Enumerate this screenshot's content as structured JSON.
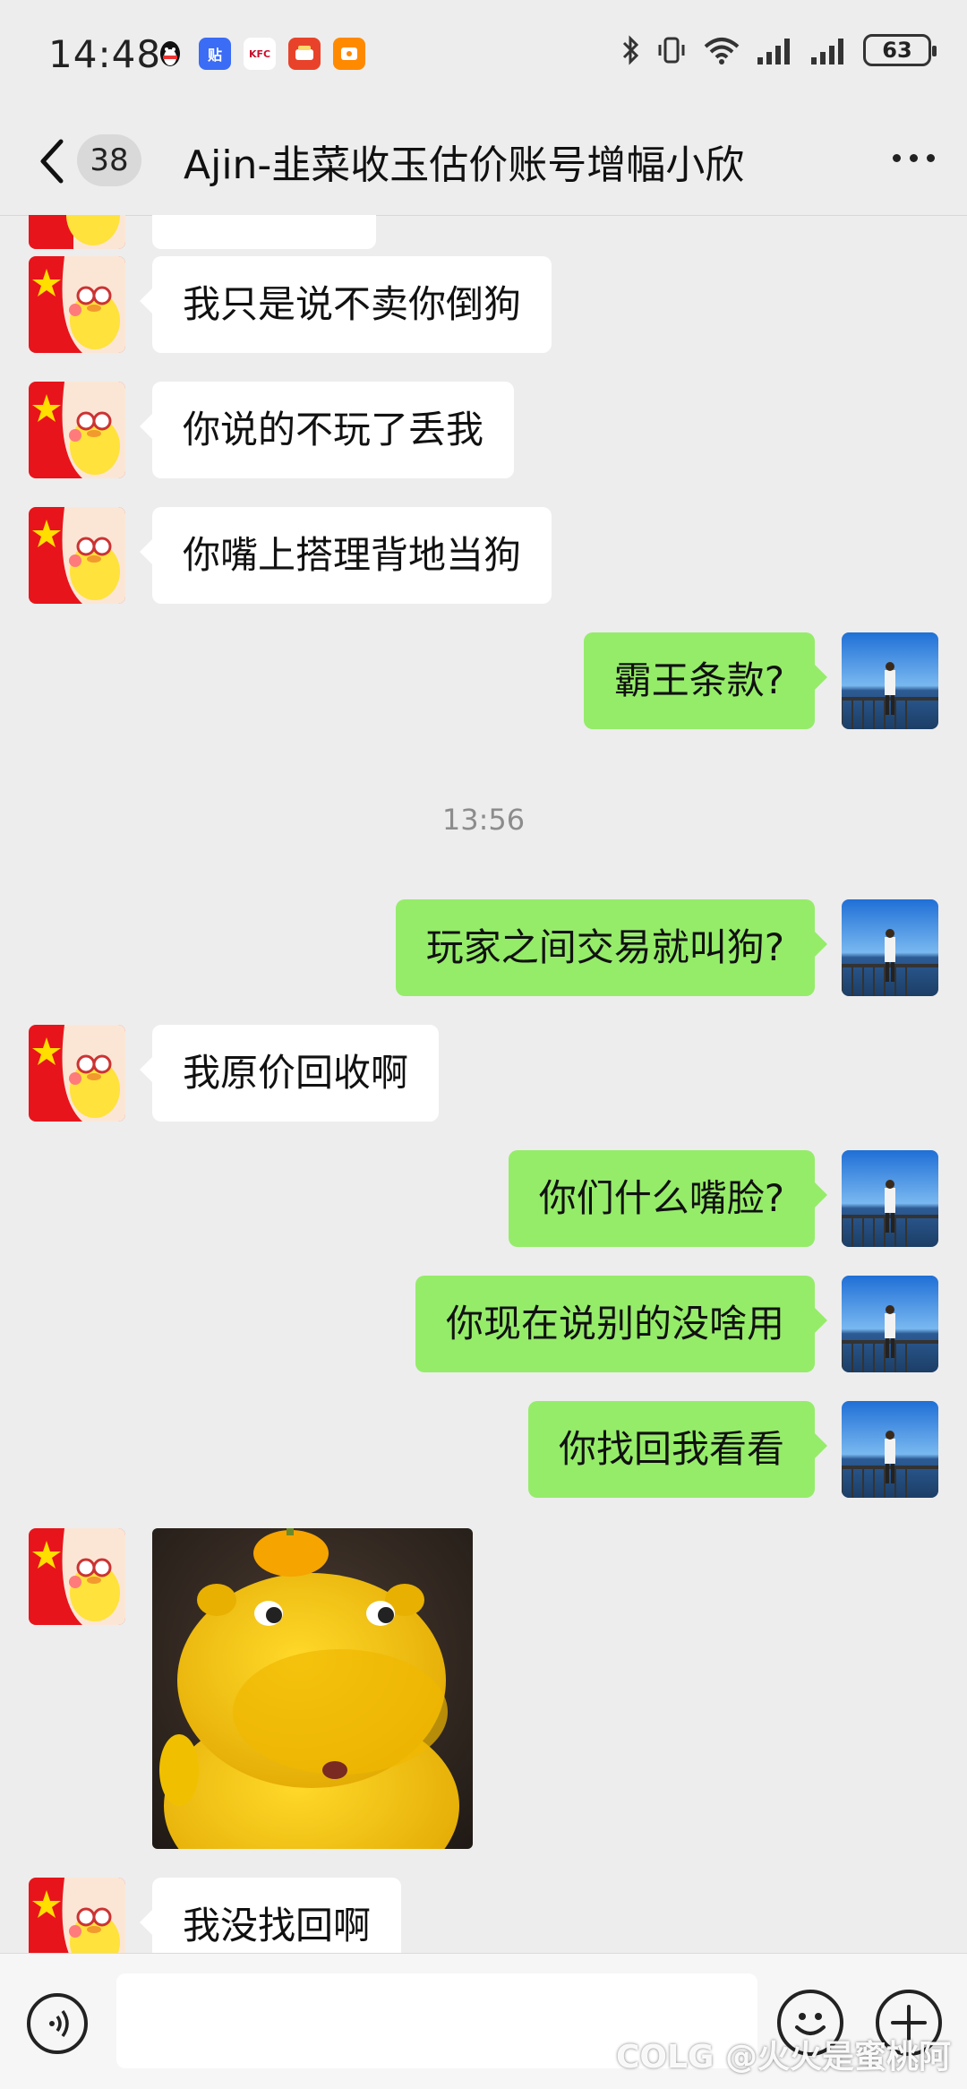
{
  "status_bar": {
    "time": "14:48",
    "battery": "63",
    "apps": [
      {
        "icon": "qq-icon",
        "label": "",
        "color": "#ffffff"
      },
      {
        "icon": "tieba-icon",
        "label": "贴",
        "color": "#3b6cf6"
      },
      {
        "icon": "kfc-icon",
        "label": "KFC",
        "color": "#c8102e"
      },
      {
        "icon": "food-app-icon",
        "label": "",
        "color": "#e8432a"
      },
      {
        "icon": "orange-app-icon",
        "label": "",
        "color": "#ff8a00"
      }
    ]
  },
  "header": {
    "unread_count": "38",
    "title": "Ajin-韭菜收玉估价账号增幅小欣"
  },
  "messages": [
    {
      "side": "in",
      "text": "我只是说不卖你倒狗"
    },
    {
      "side": "in",
      "text": "你说的不玩了丢我"
    },
    {
      "side": "in",
      "text": "你嘴上搭理背地当狗"
    },
    {
      "side": "out",
      "text": "霸王条款?"
    },
    {
      "timestamp": "13:56"
    },
    {
      "side": "out",
      "text": "玩家之间交易就叫狗?"
    },
    {
      "side": "in",
      "text": "我原价回收啊"
    },
    {
      "side": "out",
      "text": "你们什么嘴脸?"
    },
    {
      "side": "out",
      "text": "你现在说别的没啥用"
    },
    {
      "side": "out",
      "text": "你找回我看看"
    },
    {
      "side": "in",
      "sticker": "yellow-hippo-sticker"
    },
    {
      "side": "in",
      "text": "我没找回啊"
    }
  ],
  "input_bar": {
    "watermark": "COLG @火火是蜜桃阿"
  },
  "colors": {
    "outgoing_bubble": "#95ec69",
    "incoming_bubble": "#ffffff",
    "background": "#ededed"
  }
}
